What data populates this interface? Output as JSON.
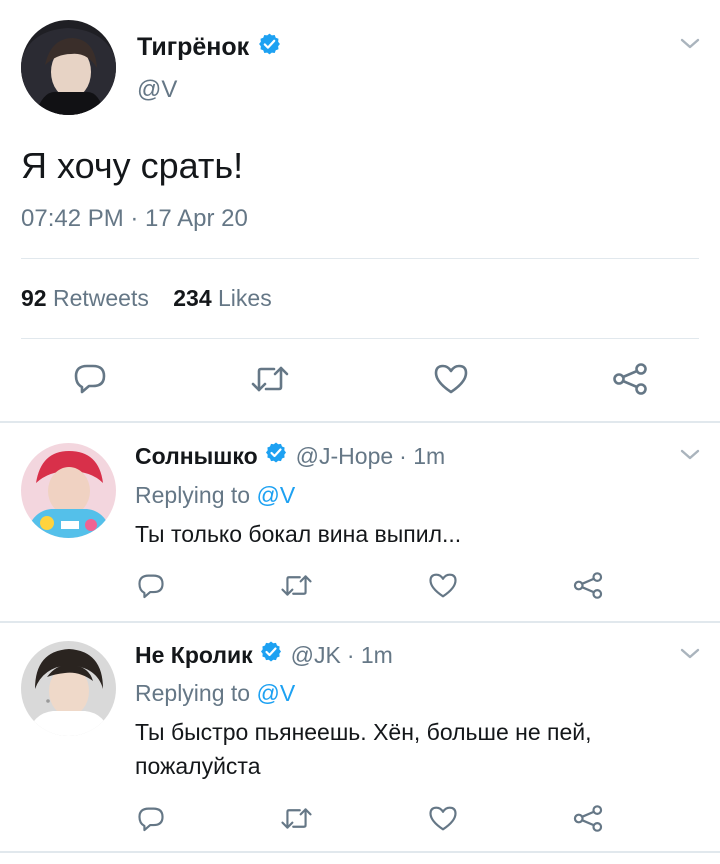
{
  "main_tweet": {
    "display_name": "Тигрёнок",
    "handle": "@V",
    "text": "Я хочу срать!",
    "timestamp": "07:42 PM · 17 Apr 20",
    "stats": {
      "retweets_count": "92",
      "retweets_label": "Retweets",
      "likes_count": "234",
      "likes_label": "Likes"
    }
  },
  "replies": [
    {
      "display_name": "Солнышко",
      "handle": "@J-Hope",
      "time": "· 1m",
      "replying_prefix": "Replying to",
      "replying_to": "@V",
      "text_lines": [
        "Ты только бокал вина выпил..."
      ]
    },
    {
      "display_name": "Не Кролик",
      "handle": "@JK",
      "time": "· 1m",
      "replying_prefix": "Replying to",
      "replying_to": "@V",
      "text_lines": [
        "Ты быстро пьянеешь. Хён, больше не пей,",
        "пожалуйста"
      ]
    }
  ],
  "icons": {
    "reply": "reply-icon",
    "retweet": "retweet-icon",
    "like": "heart-icon",
    "share": "share-icon",
    "verified": "verified-badge-icon",
    "more": "chevron-down-icon"
  },
  "colors": {
    "accent": "#1da1f2",
    "text": "#14171a",
    "muted": "#657786",
    "divider": "#e1e8ed"
  }
}
